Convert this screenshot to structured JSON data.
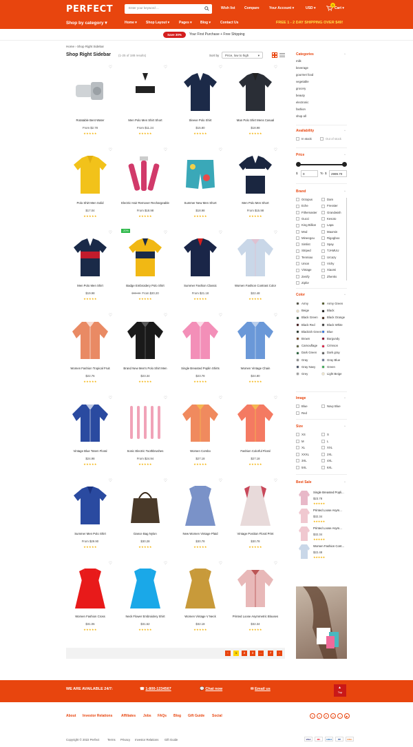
{
  "header": {
    "logo": "PERFECT",
    "search_placeholder": "Enter your keyword ...",
    "wishlist": "Wish list",
    "compare": "Compare",
    "account": "Your Account",
    "currency": "USD",
    "cart": "Cart",
    "cart_count": "0",
    "category": "Shop by category",
    "nav": [
      "Home",
      "Shop Layout",
      "Pages",
      "Blog",
      "Contact Us"
    ],
    "shipping": "FREE 1 - 2 DAY SHIPPING OVER $49!"
  },
  "promo": {
    "badge": "Save 30%",
    "text": "Your First Purchase + Free Shipping"
  },
  "breadcrumb": {
    "home": "Home",
    "current": "Shop Right Sidebar"
  },
  "page": {
    "title": "Shop Right Sidebar",
    "results": "(1-25 of 188 results)",
    "sort_label": "Sort by",
    "sort_value": "Price, low to high"
  },
  "products": [
    {
      "name": "Rotatable Bent Water",
      "price": "From $2.78",
      "old": "",
      "badge": ""
    },
    {
      "name": "Men Polo Men Shirt Short",
      "price": "From $11.24",
      "old": "",
      "badge": ""
    },
    {
      "name": "Sleeve Polo Shirt",
      "price": "$15.80",
      "old": "",
      "badge": ""
    },
    {
      "name": "Man Polo Shirt Mens Casual",
      "price": "$18.98",
      "old": "",
      "badge": ""
    },
    {
      "name": "Polo Shirt Men Solid",
      "price": "$17.04",
      "old": "",
      "badge": ""
    },
    {
      "name": "Electric Hair Remover Rechargeable",
      "price": "From $18.98",
      "old": "",
      "badge": ""
    },
    {
      "name": "Summer New Men Short",
      "price": "$18.98",
      "old": "",
      "badge": ""
    },
    {
      "name": "Men Polo Men Short",
      "price": "From $15.98",
      "old": "",
      "badge": ""
    },
    {
      "name": "Men Polo Men Shirt",
      "price": "$19.98",
      "old": "",
      "badge": ""
    },
    {
      "name": "Badge Embroidery Polo Shirt",
      "price": "From $20.20",
      "old": "$90.98",
      "badge": "-20%"
    },
    {
      "name": "Summer Fashion Classic",
      "price": "From $21.18",
      "old": "",
      "badge": ""
    },
    {
      "name": "Women Fashion Contrast Color",
      "price": "$22.48",
      "old": "",
      "badge": ""
    },
    {
      "name": "Women Fashion Tropical Fruit",
      "price": "$22.76",
      "old": "",
      "badge": ""
    },
    {
      "name": "Brand New Men's Polo Shirt Men",
      "price": "$23.34",
      "old": "",
      "badge": ""
    },
    {
      "name": "Single Breasted Poplin Shirts",
      "price": "$23.78",
      "old": "",
      "badge": ""
    },
    {
      "name": "Women Vintage Chain",
      "price": "$24.80",
      "old": "",
      "badge": ""
    },
    {
      "name": "Vintage Blue Totem Floral",
      "price": "$24.98",
      "old": "",
      "badge": ""
    },
    {
      "name": "Sonic Electric Toothbrushes",
      "price": "From $24.94",
      "old": "",
      "badge": ""
    },
    {
      "name": "Women Combo",
      "price": "$27.18",
      "old": "",
      "badge": ""
    },
    {
      "name": "Fashion Colorful Floral",
      "price": "$27.18",
      "old": "",
      "badge": ""
    },
    {
      "name": "Summer Men Polo Shirt",
      "price": "From $29.90",
      "old": "",
      "badge": ""
    },
    {
      "name": "Dance Bag Nylon",
      "price": "$30.28",
      "old": "",
      "badge": ""
    },
    {
      "name": "New Women Vintage Plaid",
      "price": "$30.78",
      "old": "",
      "badge": ""
    },
    {
      "name": "Vintage Position Floral Print",
      "price": "$30.78",
      "old": "",
      "badge": ""
    },
    {
      "name": "Women Fashion Cross",
      "price": "$31.06",
      "old": "",
      "badge": ""
    },
    {
      "name": "Neck Flower Embroidery Shirt",
      "price": "$31.52",
      "old": "",
      "badge": ""
    },
    {
      "name": "Women Vintage V Neck",
      "price": "$32.18",
      "old": "",
      "badge": ""
    },
    {
      "name": "Printed Loose Asymmetric Blouses",
      "price": "$32.34",
      "old": "",
      "badge": ""
    }
  ],
  "stars": "★★★★★",
  "pagination": [
    "‹",
    "1",
    "2",
    "3",
    "…",
    "7",
    "›"
  ],
  "sidebar": {
    "categories_title": "Categories",
    "categories": [
      "milk",
      "beverage",
      "gourmet food",
      "vegetable",
      "grocery",
      "beauty",
      "electronic",
      "fashion",
      "shop all"
    ],
    "availability_title": "Availability",
    "in_stock": "In stock",
    "out_stock": "Out of stock",
    "price_title": "Price",
    "price_min": "0",
    "price_max": "2999.70",
    "to": "To",
    "cur": "$",
    "brand_title": "Brand",
    "brands_left": [
      "Octopus",
      "Eche",
      "Fithemaster",
      "Gucci",
      "King Billion",
      "Mnd",
      "Mineegou",
      "Simlist",
      "Striped",
      "Tenmiao",
      "Union",
      "Vintage",
      "Zenify",
      "Zipfor"
    ],
    "brands_right": [
      "Dam",
      "Fresster",
      "Grandwish",
      "Kesoto",
      "Lapa",
      "Maomin",
      "Rigogboo",
      "Spay",
      "TJAMUU",
      "Urcazy",
      "Vichy",
      "Xiaomi",
      "Zhenks",
      ""
    ],
    "color_title": "Color",
    "colors_left": [
      [
        "Army",
        "#4a4a3a"
      ],
      [
        "Beige",
        "#e8dcc0"
      ],
      [
        "Black Green",
        "#1c3a2a"
      ],
      [
        "Black Red",
        "#3a0e10"
      ],
      [
        "Blackish Green",
        "#1e2e22"
      ],
      [
        "Brown",
        "#6b3c1e"
      ],
      [
        "Camouflage",
        "#5a5e3a"
      ],
      [
        "Dark Green",
        "#1e5e32"
      ],
      [
        "Gray",
        "#888888"
      ],
      [
        "Gray Navy",
        "#3e4a5e"
      ],
      [
        "Grey",
        "#9a9a9a"
      ]
    ],
    "colors_right": [
      [
        "Army Green",
        "#4b5320"
      ],
      [
        "Black",
        "#111111"
      ],
      [
        "Black Orange",
        "#3a1e0e"
      ],
      [
        "Black White",
        "#333333"
      ],
      [
        "Blue",
        "#2a6ede"
      ],
      [
        "Burgundy",
        "#800020"
      ],
      [
        "Crimson",
        "#dc143c"
      ],
      [
        "Dark gray",
        "#555555"
      ],
      [
        "Gray Blue",
        "#5e6e8e"
      ],
      [
        "Green",
        "#2ea84a"
      ],
      [
        "Light Beige",
        "#efe4c8"
      ]
    ],
    "image_title": "Image",
    "images": [
      [
        "Blue",
        "Navy Blue"
      ],
      [
        "Red",
        ""
      ]
    ],
    "size_title": "Size",
    "sizes": [
      [
        "XS",
        "S"
      ],
      [
        "M",
        "L"
      ],
      [
        "XL",
        "XXL"
      ],
      [
        "XXXL",
        "2XL"
      ],
      [
        "3XL",
        "4XL"
      ],
      [
        "5XL",
        "6XL"
      ]
    ],
    "bestsale_title": "Best Sale",
    "bestsale": [
      [
        "Single Breasted Popli...",
        "$23.78"
      ],
      [
        "Printed Loose Asym...",
        "$32.34"
      ],
      [
        "Printed Loose Asym...",
        "$32.34"
      ],
      [
        "Women Fashion Cont...",
        "$22.48"
      ]
    ]
  },
  "footer": {
    "available": "WE ARE AVAILABLE 24/7:",
    "phone": "1-800-1234567",
    "chat": "Chat now",
    "email": "Email us",
    "top": "Top",
    "links": [
      "About",
      "Investor Relations",
      "Affiliates",
      "Jobs",
      "FAQs",
      "Blog",
      "Gift Guide",
      "Social"
    ],
    "copyright": "Copyright © 2022 Perfect",
    "bottom_links": [
      "Terms",
      "Privacy",
      "Investor Relations",
      "Gift Guide"
    ],
    "payments": [
      "VISA",
      "MC",
      "AMEX",
      "PP",
      "DISC"
    ],
    "social_icons": [
      "twitter-icon",
      "facebook-icon",
      "pinterest-icon",
      "instagram-icon",
      "tiktok-icon",
      "youtube-icon"
    ]
  }
}
